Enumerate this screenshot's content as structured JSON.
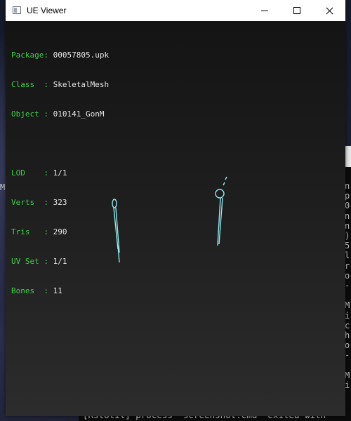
{
  "window": {
    "title": "UE Viewer",
    "icon": "window-app-icon",
    "controls": {
      "minimize": "minimize-icon",
      "maximize": "maximize-icon",
      "close": "close-icon"
    }
  },
  "info": {
    "package": {
      "label": "Package:",
      "value": "00057805.upk"
    },
    "class": {
      "label": "Class  :",
      "value": "SkeletalMesh"
    },
    "object": {
      "label": "Object :",
      "value": "010141_GonM"
    },
    "lod": {
      "label": "LOD    :",
      "value": "1/1"
    },
    "verts": {
      "label": "Verts  :",
      "value": "323"
    },
    "tris": {
      "label": "Tris   :",
      "value": "290"
    },
    "uvset": {
      "label": "UV Set :",
      "value": "1/1"
    },
    "bones": {
      "label": "Bones  :",
      "value": "11"
    }
  },
  "background": {
    "left_glyph": "M",
    "console_right_chars": "n\np\n0\nn\nn\n)\n5\nl\nr\no\n-\n\nM\ni\nc\nh\no\n-\n\nM\ni",
    "console_bottom_text": "[RstUtil] process \"screenshot.cmd\" exited with"
  },
  "colors": {
    "label": "#3ecf4a",
    "value": "#e6e6e6",
    "mesh": "#8fe8ee"
  }
}
